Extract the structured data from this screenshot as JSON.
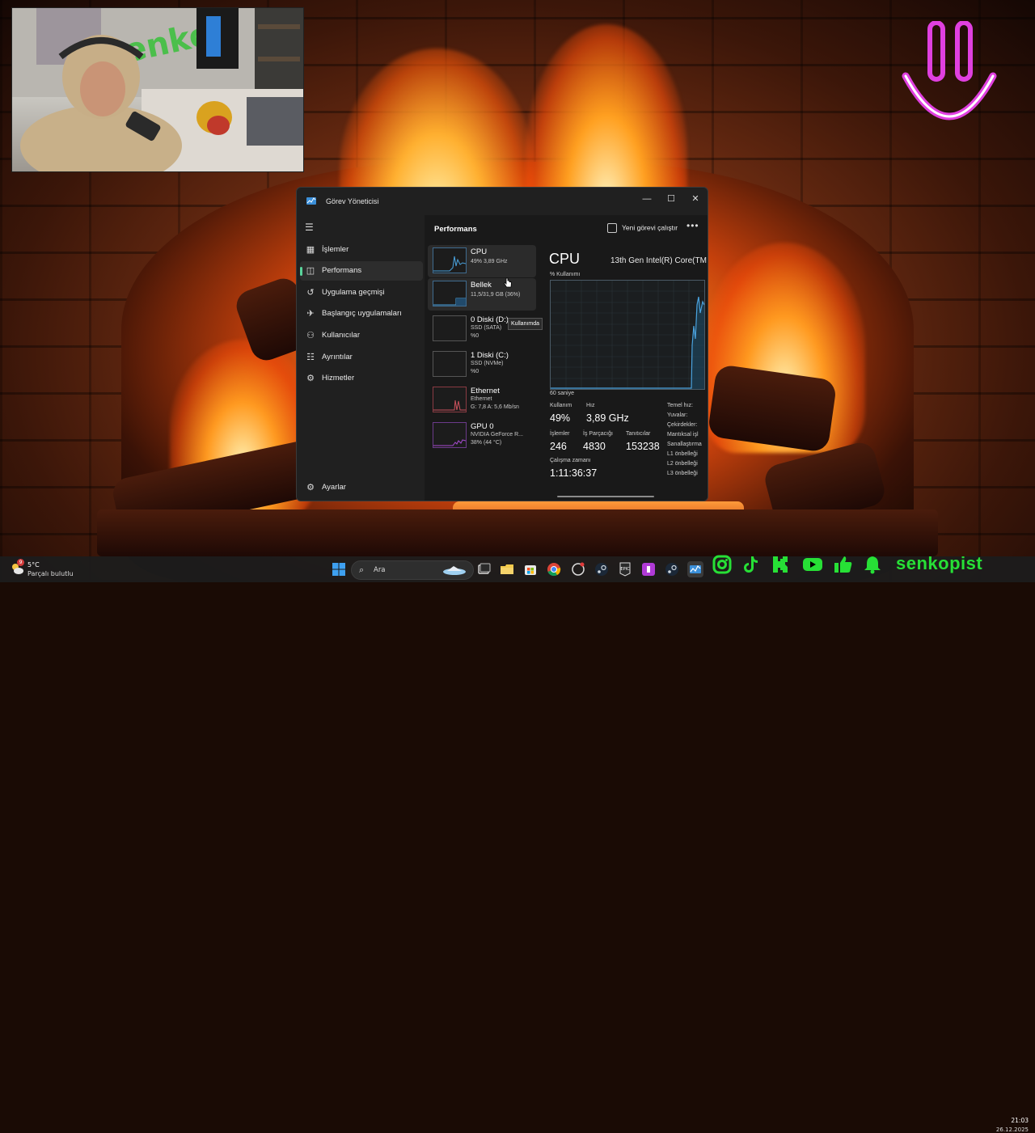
{
  "taskmanager": {
    "title": "Görev Yöneticisi",
    "nav": [
      {
        "label": "İşlemler",
        "icon": "processes-icon"
      },
      {
        "label": "Performans",
        "icon": "performance-icon"
      },
      {
        "label": "Uygulama geçmişi",
        "icon": "history-icon"
      },
      {
        "label": "Başlangıç uygulamaları",
        "icon": "startup-icon"
      },
      {
        "label": "Kullanıcılar",
        "icon": "users-icon"
      },
      {
        "label": "Ayrıntılar",
        "icon": "details-icon"
      },
      {
        "label": "Hizmetler",
        "icon": "services-icon"
      }
    ],
    "settings_label": "Ayarlar",
    "page_title": "Performans",
    "run_task_label": "Yeni görevi çalıştır",
    "devices": [
      {
        "name": "CPU",
        "lines": [
          "49% 3,89 GHz"
        ],
        "color": "#4aa3df"
      },
      {
        "name": "Bellek",
        "lines": [
          "11,5/31,9 GB (36%)"
        ],
        "color": "#4aa3df"
      },
      {
        "name": "0 Diski (D:)",
        "lines": [
          "SSD (SATA)",
          "%0"
        ],
        "color": "#6a6a6a"
      },
      {
        "name": "1 Diski (C:)",
        "lines": [
          "SSD (NVMe)",
          "%0"
        ],
        "color": "#6a6a6a"
      },
      {
        "name": "Ethernet",
        "lines": [
          "Ethernet",
          "G: 7,8 A: 5,6 Mb/sn"
        ],
        "color": "#c9515c"
      },
      {
        "name": "GPU 0",
        "lines": [
          "NVIDIA GeForce R...",
          "38% (44 °C)"
        ],
        "color": "#a74ad1"
      }
    ],
    "tooltip": "Kullanımda",
    "detail": {
      "heading": "CPU",
      "model": "13th Gen Intel(R) Core(TM",
      "usage_label": "% Kullanımı",
      "graph_span": "60 saniye",
      "stats": {
        "usage_label": "Kullanım",
        "usage": "49%",
        "speed_label": "Hız",
        "speed": "3,89 GHz",
        "processes_label": "İşlemler",
        "processes": "246",
        "threads_label": "İş Parçacığı",
        "threads": "4830",
        "handles_label": "Tanıtıcılar",
        "handles": "153238",
        "uptime_label": "Çalışma zamanı",
        "uptime": "1:11:36:37"
      },
      "right_labels": [
        "Temel hız:",
        "Yuvalar:",
        "Çekirdekler:",
        "Mantıksal işl",
        "Sanallaştırma",
        "L1 önbelleği",
        "L2 önbelleği",
        "L3 önbelleği"
      ]
    }
  },
  "taskbar": {
    "weather_temp": "5°C",
    "weather_desc": "Parçalı bulutlu",
    "weather_badge": "9",
    "search_placeholder": "Ara",
    "time": "21:03",
    "date": "26.12.2025"
  },
  "overlay": {
    "brand": "senkopist",
    "socials": [
      "instagram-icon",
      "tiktok-icon",
      "kick-icon",
      "youtube-icon",
      "like-icon",
      "bell-icon"
    ],
    "brand_color": "#27e036",
    "smiley_color": "#e040e0"
  }
}
